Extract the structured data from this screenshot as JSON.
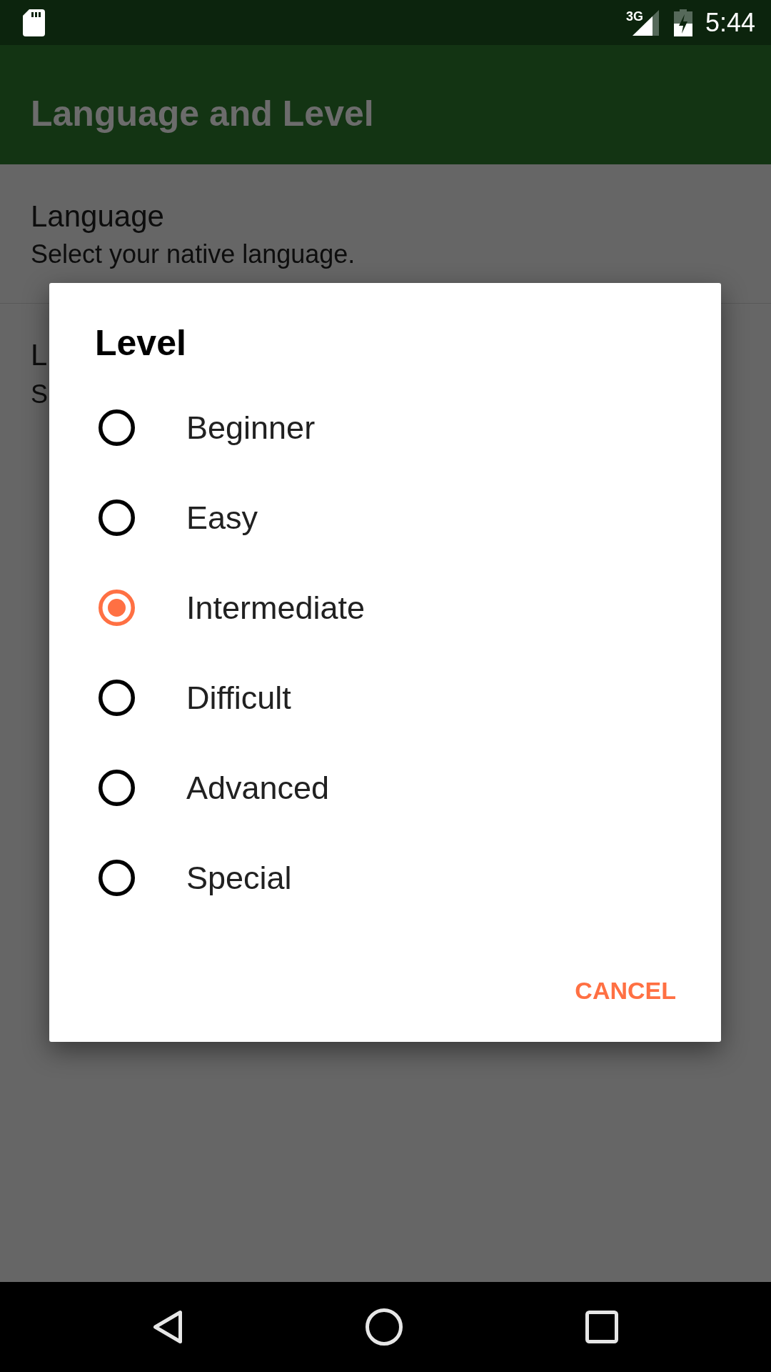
{
  "status_bar": {
    "network": "3G",
    "time": "5:44"
  },
  "app_bar": {
    "title": "Language and Level"
  },
  "settings": [
    {
      "title": "Language",
      "summary": "Select your native language."
    },
    {
      "title": "L",
      "summary": "S"
    }
  ],
  "dialog": {
    "title": "Level",
    "options": [
      {
        "label": "Beginner",
        "selected": false
      },
      {
        "label": "Easy",
        "selected": false
      },
      {
        "label": "Intermediate",
        "selected": true
      },
      {
        "label": "Difficult",
        "selected": false
      },
      {
        "label": "Advanced",
        "selected": false
      },
      {
        "label": "Special",
        "selected": false
      }
    ],
    "buttons": [
      "CANCEL"
    ]
  }
}
